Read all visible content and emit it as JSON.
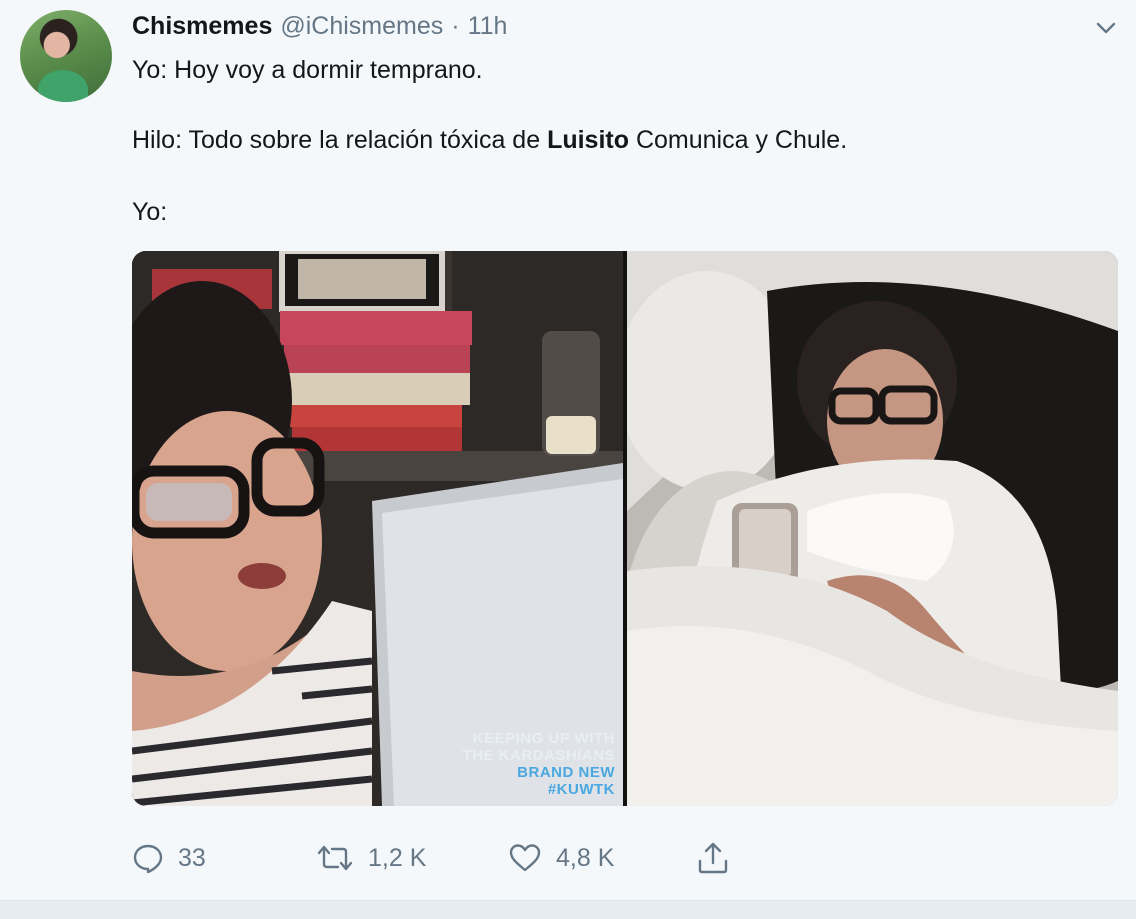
{
  "tweet": {
    "author_name": "Chismemes",
    "author_handle": "@iChismemes",
    "separator": "·",
    "time": "11h",
    "line1": "Yo: Hoy voy a dormir temprano.",
    "line2_before": "Hilo: Todo sobre la relación tóxica de ",
    "line2_bold": "Luisito",
    "line2_after": " Comunica y Chule.",
    "line3": "Yo:"
  },
  "media": {
    "watermark_line1": "KEEPING UP WITH",
    "watermark_line2": "THE KARDASHIANS",
    "watermark_line3": "BRAND NEW",
    "watermark_line4": "#KUWTK",
    "watermark_colors": {
      "white": "#e8eef2",
      "blue": "#4aa8e0"
    }
  },
  "actions": {
    "reply_count": "33",
    "retweet_count": "1,2 K",
    "like_count": "4,8 K"
  },
  "icons": {
    "caret": "chevron-down-icon",
    "reply": "reply-icon",
    "retweet": "retweet-icon",
    "like": "heart-icon",
    "share": "share-icon"
  },
  "colors": {
    "background": "#f5f8fa",
    "text": "#14171a",
    "muted": "#657786"
  }
}
